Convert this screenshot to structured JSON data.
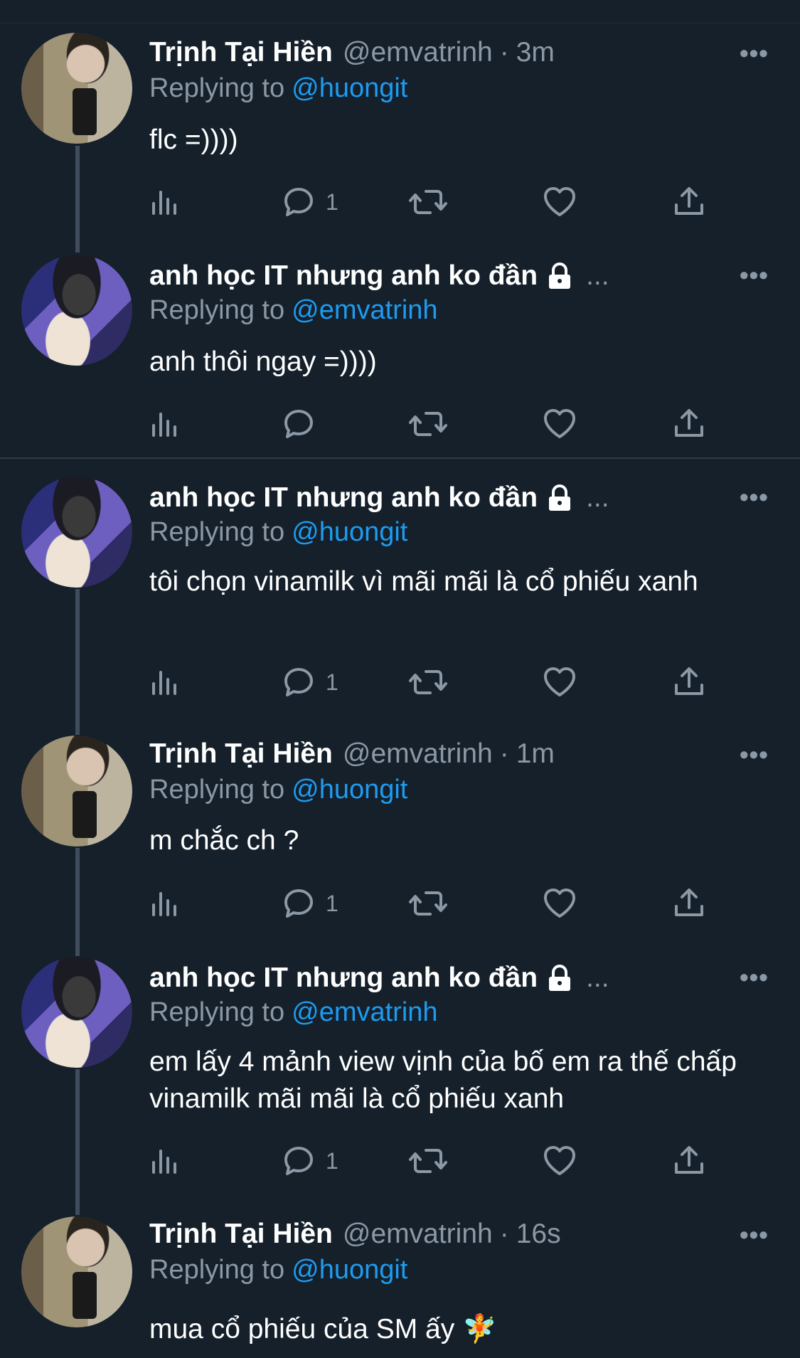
{
  "colors": {
    "background": "#15202b",
    "text": "#ffffff",
    "muted": "#8b98a5",
    "accent": "#1d9bf0"
  },
  "reply_prefix": "Replying to",
  "tweets": [
    {
      "name": "Trịnh Tại Hiền",
      "handle": "@emvatrinh",
      "time": "3m",
      "reply_to": "@huongit",
      "text": "flc =))))",
      "reply_count": "1",
      "avatar": "avatar-mirror-selfie"
    },
    {
      "name": "anh học IT nhưng anh ko đần",
      "locked": true,
      "ellipsis": "...",
      "reply_to": "@emvatrinh",
      "text": "anh thôi ngay =))))",
      "reply_count": "",
      "avatar": "avatar-masked"
    },
    {
      "name": "anh học IT nhưng anh ko đần",
      "locked": true,
      "ellipsis": "...",
      "reply_to": "@huongit",
      "text": "tôi chọn vinamilk vì mãi mãi là cổ phiếu xanh",
      "reply_count": "1",
      "avatar": "avatar-masked"
    },
    {
      "name": "Trịnh Tại Hiền",
      "handle": "@emvatrinh",
      "time": "1m",
      "reply_to": "@huongit",
      "text": "m chắc ch ?",
      "reply_count": "1",
      "avatar": "avatar-mirror-selfie"
    },
    {
      "name": "anh học IT nhưng anh ko đần",
      "locked": true,
      "ellipsis": "...",
      "reply_to": "@emvatrinh",
      "text": "em lấy 4 mảnh view vịnh của bố em ra thế chấp vinamilk mãi mãi là cổ phiếu xanh",
      "reply_count": "1",
      "avatar": "avatar-masked"
    },
    {
      "name": "Trịnh Tại Hiền",
      "handle": "@emvatrinh",
      "time": "16s",
      "reply_to": "@huongit",
      "text": "mua cổ phiếu của SM ấy 🧚",
      "reply_count": "",
      "avatar": "avatar-mirror-selfie"
    }
  ]
}
